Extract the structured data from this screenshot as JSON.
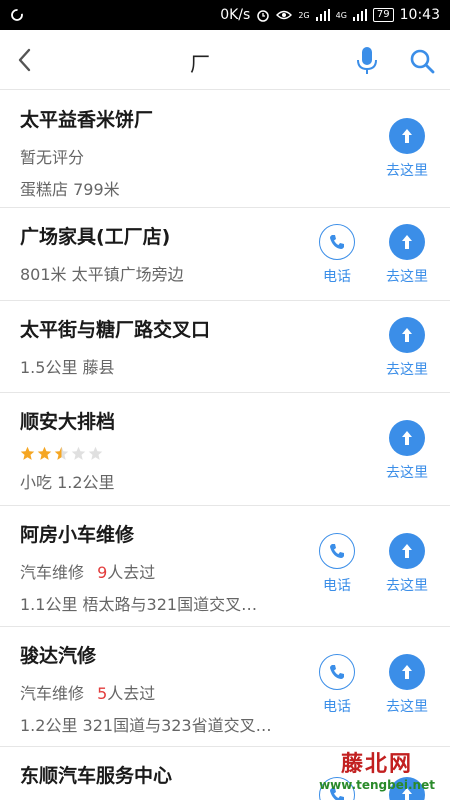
{
  "status_bar": {
    "speed": "0K/s",
    "network_2g": "2G",
    "network_4g": "4G",
    "battery": "79",
    "time": "10:43"
  },
  "header": {
    "query": "厂"
  },
  "actions": {
    "go_label": "去这里",
    "phone_label": "电话"
  },
  "results": [
    {
      "title": "太平益香米饼厂",
      "line1": "暂无评分",
      "line2": "蛋糕店  799米",
      "has_phone": false
    },
    {
      "title": "广场家具(工厂店)",
      "line1": "801米  太平镇广场旁边",
      "has_phone": true
    },
    {
      "title": "太平街与糖厂路交叉口",
      "line1": "1.5公里  藤县",
      "has_phone": false
    },
    {
      "title": "顺安大排档",
      "rating": 2.5,
      "line2": "小吃  1.2公里",
      "has_phone": false
    },
    {
      "title": "阿房小车维修",
      "category": "汽车维修",
      "visits": "9",
      "visits_suffix": "人去过",
      "line2": "1.1公里  梧太路与321国道交叉…",
      "has_phone": true
    },
    {
      "title": "骏达汽修",
      "category": "汽车维修",
      "visits": "5",
      "visits_suffix": "人去过",
      "line2": "1.2公里  321国道与323省道交叉…",
      "has_phone": true
    },
    {
      "title": "东顺汽车服务中心",
      "has_phone": true
    }
  ],
  "watermark": {
    "title": "藤北网",
    "url": "www.tengbei.net"
  },
  "colors": {
    "accent": "#3b8ee8",
    "highlight": "#e23c3c",
    "star": "#f5a623"
  }
}
